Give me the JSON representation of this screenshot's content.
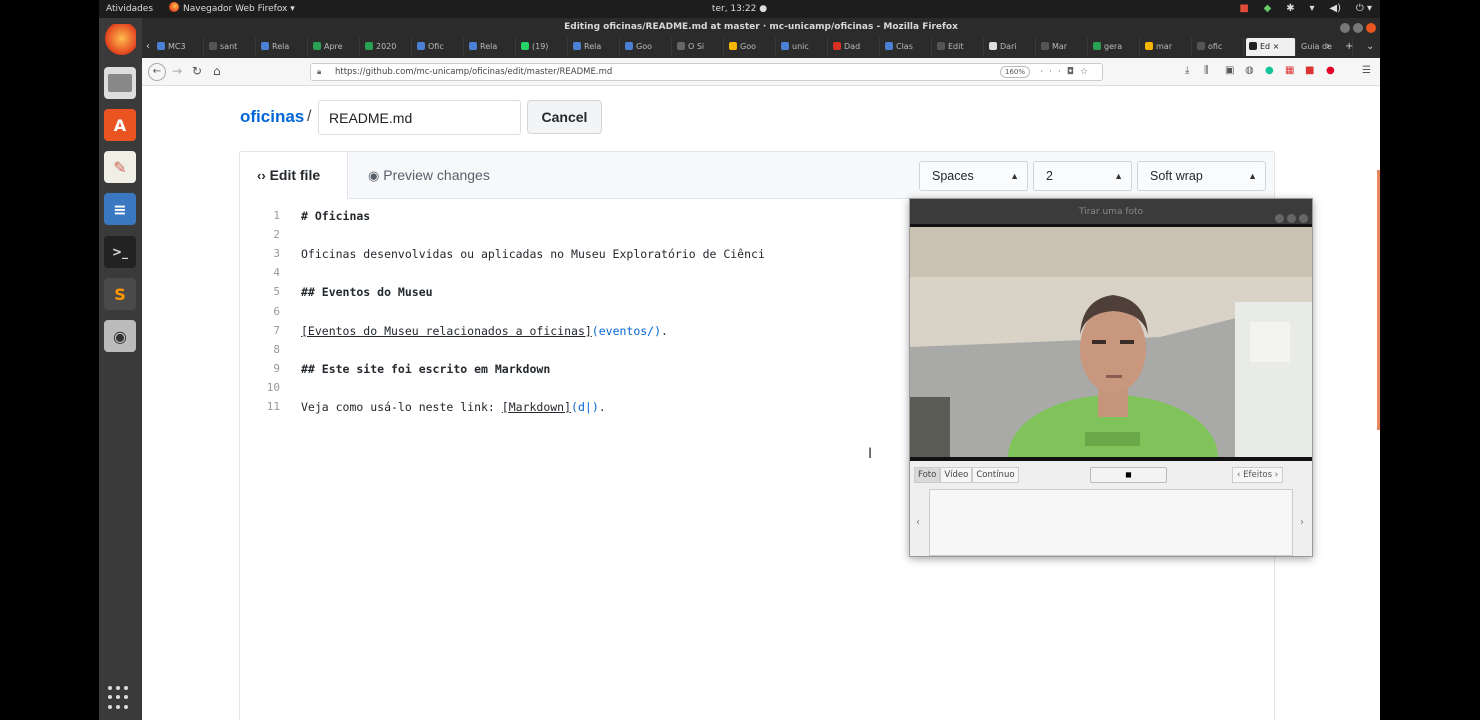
{
  "topbar": {
    "activities": "Atividades",
    "app_menu": "Navegador Web Firefox ▾",
    "clock": "ter, 13:22 ●"
  },
  "window": {
    "title": "Editing oficinas/README.md at master · mc-unicamp/oficinas - Mozilla Firefox"
  },
  "tabs": [
    {
      "label": "MC3",
      "color": "#4a7fd4"
    },
    {
      "label": "sant",
      "color": "#555555"
    },
    {
      "label": "Rela",
      "color": "#4a7fd4"
    },
    {
      "label": "Apre",
      "color": "#2aa052"
    },
    {
      "label": "2020",
      "color": "#2aa052"
    },
    {
      "label": "Ofic",
      "color": "#4a7fd4"
    },
    {
      "label": "Rela",
      "color": "#4a7fd4"
    },
    {
      "label": "(19)",
      "color": "#25d366"
    },
    {
      "label": "Rela",
      "color": "#4a7fd4"
    },
    {
      "label": "Goo",
      "color": "#4a7fd4"
    },
    {
      "label": "O Si",
      "color": "#666666"
    },
    {
      "label": "Goo",
      "color": "#f4b400"
    },
    {
      "label": "unic",
      "color": "#4a7fd4"
    },
    {
      "label": "Dad",
      "color": "#d93025"
    },
    {
      "label": "Clas",
      "color": "#4a7fd4"
    },
    {
      "label": "Edit",
      "color": "#555555"
    },
    {
      "label": "Dari",
      "color": "#dddddd"
    },
    {
      "label": "Mar",
      "color": "#555555"
    },
    {
      "label": "gera",
      "color": "#2aa052"
    },
    {
      "label": "mar",
      "color": "#f4b400"
    },
    {
      "label": "ofic",
      "color": "#555555"
    },
    {
      "label": "Ed",
      "color": "#222222"
    },
    {
      "label": "Guia de",
      "color": "#2b2b2b"
    }
  ],
  "nav": {
    "url": "https://github.com/mc-unicamp/oficinas/edit/master/README.md",
    "zoom": "160%"
  },
  "page": {
    "repo": "oficinas",
    "separator": "/",
    "filename": "README.md",
    "cancel": "Cancel",
    "tab_edit": "Edit file",
    "tab_preview": "Preview changes",
    "indent_mode": "Spaces",
    "indent_size": "2",
    "wrap_mode": "Soft wrap"
  },
  "code_lines": [
    {
      "n": "1",
      "text": "# Oficinas"
    },
    {
      "n": "2",
      "text": ""
    },
    {
      "n": "3",
      "text": "Oficinas desenvolvidas ou aplicadas no Museu Exploratório de Ciênci"
    },
    {
      "n": "4",
      "text": ""
    },
    {
      "n": "5",
      "text": "## Eventos do Museu"
    },
    {
      "n": "6",
      "text": ""
    },
    {
      "n": "7",
      "link_text": "[Eventos do Museu relacionados a oficinas]",
      "link_url": "(eventos/)",
      "tail": "."
    },
    {
      "n": "8",
      "text": ""
    },
    {
      "n": "9",
      "text": "## Este site foi escrito em Markdown"
    },
    {
      "n": "10",
      "text": ""
    },
    {
      "n": "11",
      "prefix": "Veja como usá-lo neste link: ",
      "link_text": "[Markdown]",
      "link_url": "(d|)",
      "tail": "."
    }
  ],
  "cheese": {
    "title": "Tirar uma foto",
    "mode_photo": "Foto",
    "mode_video": "Vídeo",
    "mode_burst": "Contínuo",
    "effects": "Efeitos"
  },
  "grammarly": "G"
}
